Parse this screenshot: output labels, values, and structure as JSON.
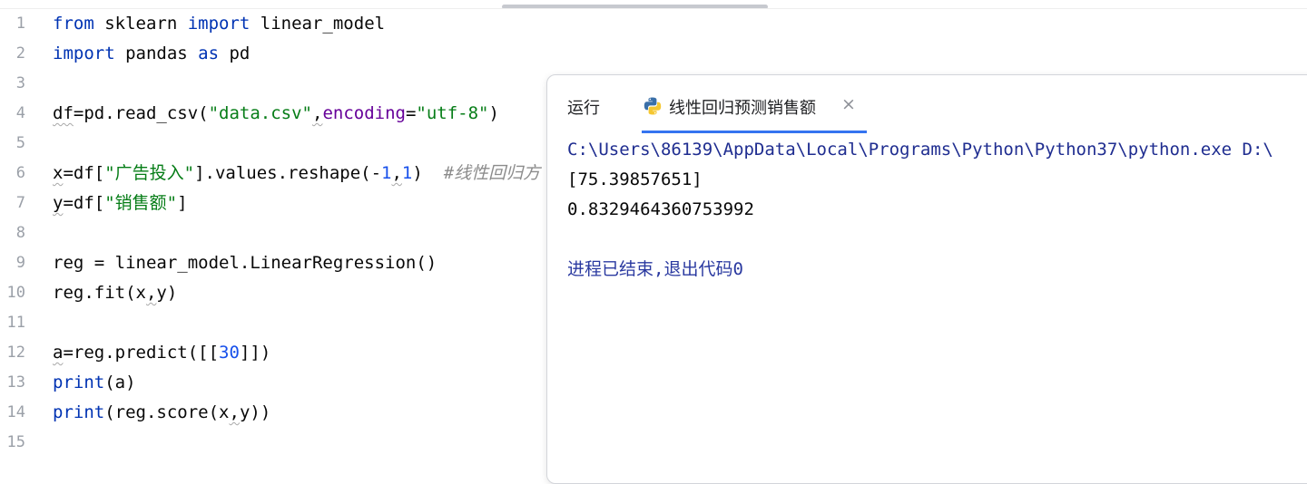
{
  "editor": {
    "line_numbers": [
      "1",
      "2",
      "3",
      "4",
      "5",
      "6",
      "7",
      "8",
      "9",
      "10",
      "11",
      "12",
      "13",
      "14",
      "15"
    ],
    "l1": {
      "from": "from",
      "mod": " sklearn ",
      "imp": "import",
      "rest": " linear_model"
    },
    "l2": {
      "imp": "import",
      "mid": " pandas ",
      "as": "as",
      "rest": " pd"
    },
    "l4": {
      "a": "df",
      "b": "=pd.read_csv(",
      "s1": "\"data.csv\"",
      "comma": ",",
      "kw": "encoding",
      "eq": "=",
      "s2": "\"utf-8\"",
      "end": ")"
    },
    "l6": {
      "a": "x",
      "b": "=df[",
      "s": "\"广告投入\"",
      "c": "].values.reshape(-",
      "n1": "1",
      "comma": ",",
      "n2": "1",
      "d": ")  ",
      "cmt": "#线性回归方"
    },
    "l7": {
      "a": "y",
      "b": "=df[",
      "s": "\"销售额\"",
      "c": "]"
    },
    "l9": {
      "text": "reg = linear_model.LinearRegression()"
    },
    "l10": {
      "a": "reg.fit(x",
      "comma": ",",
      "b": "y)"
    },
    "l12": {
      "a": "a",
      "b": "=reg.predict([[",
      "n": "30",
      "c": "]])"
    },
    "l13": {
      "fn": "print",
      "rest": "(a)"
    },
    "l14": {
      "fn": "print",
      "a": "(reg.score(x",
      "comma": ",",
      "b": "y))"
    }
  },
  "run_panel": {
    "label": "运行",
    "tab": {
      "title": "线性回归预测销售额",
      "close": "×",
      "icon": "python-icon"
    },
    "output": {
      "command": "C:\\Users\\86139\\AppData\\Local\\Programs\\Python\\Python37\\python.exe D:\\",
      "prediction": "[75.39857651]",
      "score": "0.8329464360753992",
      "exit_message": "进程已结束,退出代码0"
    }
  },
  "colors": {
    "keyword": "#0033b3",
    "string": "#067d17",
    "number": "#1750eb",
    "accent": "#3574f0"
  }
}
